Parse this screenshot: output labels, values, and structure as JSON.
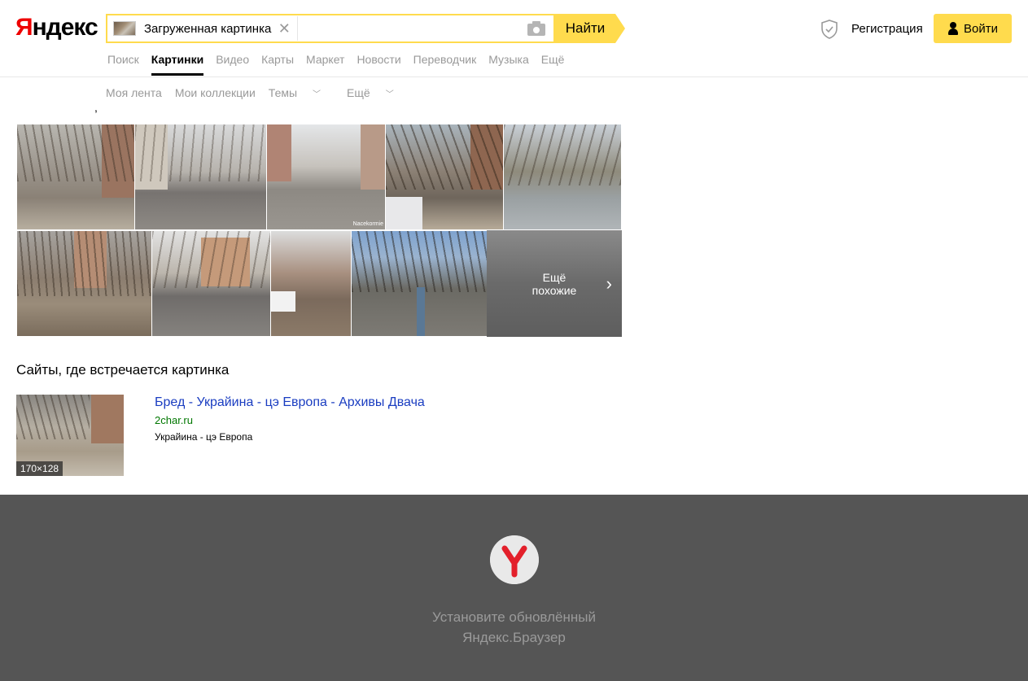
{
  "header": {
    "logo_first": "Я",
    "logo_rest": "ндекс",
    "search_chip_label": "Загруженная картинка",
    "find_label": "Найти",
    "register_label": "Регистрация",
    "login_label": "Войти"
  },
  "services": [
    {
      "label": "Поиск",
      "active": false
    },
    {
      "label": "Картинки",
      "active": true
    },
    {
      "label": "Видео",
      "active": false
    },
    {
      "label": "Карты",
      "active": false
    },
    {
      "label": "Маркет",
      "active": false
    },
    {
      "label": "Новости",
      "active": false
    },
    {
      "label": "Переводчик",
      "active": false
    },
    {
      "label": "Музыка",
      "active": false
    },
    {
      "label": "Ещё",
      "active": false
    }
  ],
  "subnav": {
    "feed": "Моя лента",
    "collections": "Мои коллекции",
    "topics": "Темы",
    "more": "Ещё"
  },
  "similar": {
    "more_line1": "Ещё",
    "more_line2": "похожие",
    "watermark": "Nacekormie"
  },
  "sites": {
    "title": "Сайты, где встречается картинка",
    "items": [
      {
        "thumb_size": "170×128",
        "title": "Бред - Украйина - цэ Европа - Архивы Двача",
        "domain": "2char.ru",
        "description": "Украйина - цэ Европа"
      }
    ]
  },
  "footer": {
    "line1": "Установите обновлённый",
    "line2": "Яндекс.Браузер"
  },
  "colors": {
    "accent_yellow": "#ffdb4d",
    "logo_red": "#ee0000",
    "link_blue": "#1a3dc1",
    "domain_green": "#007700",
    "footer_bg": "#555555"
  }
}
